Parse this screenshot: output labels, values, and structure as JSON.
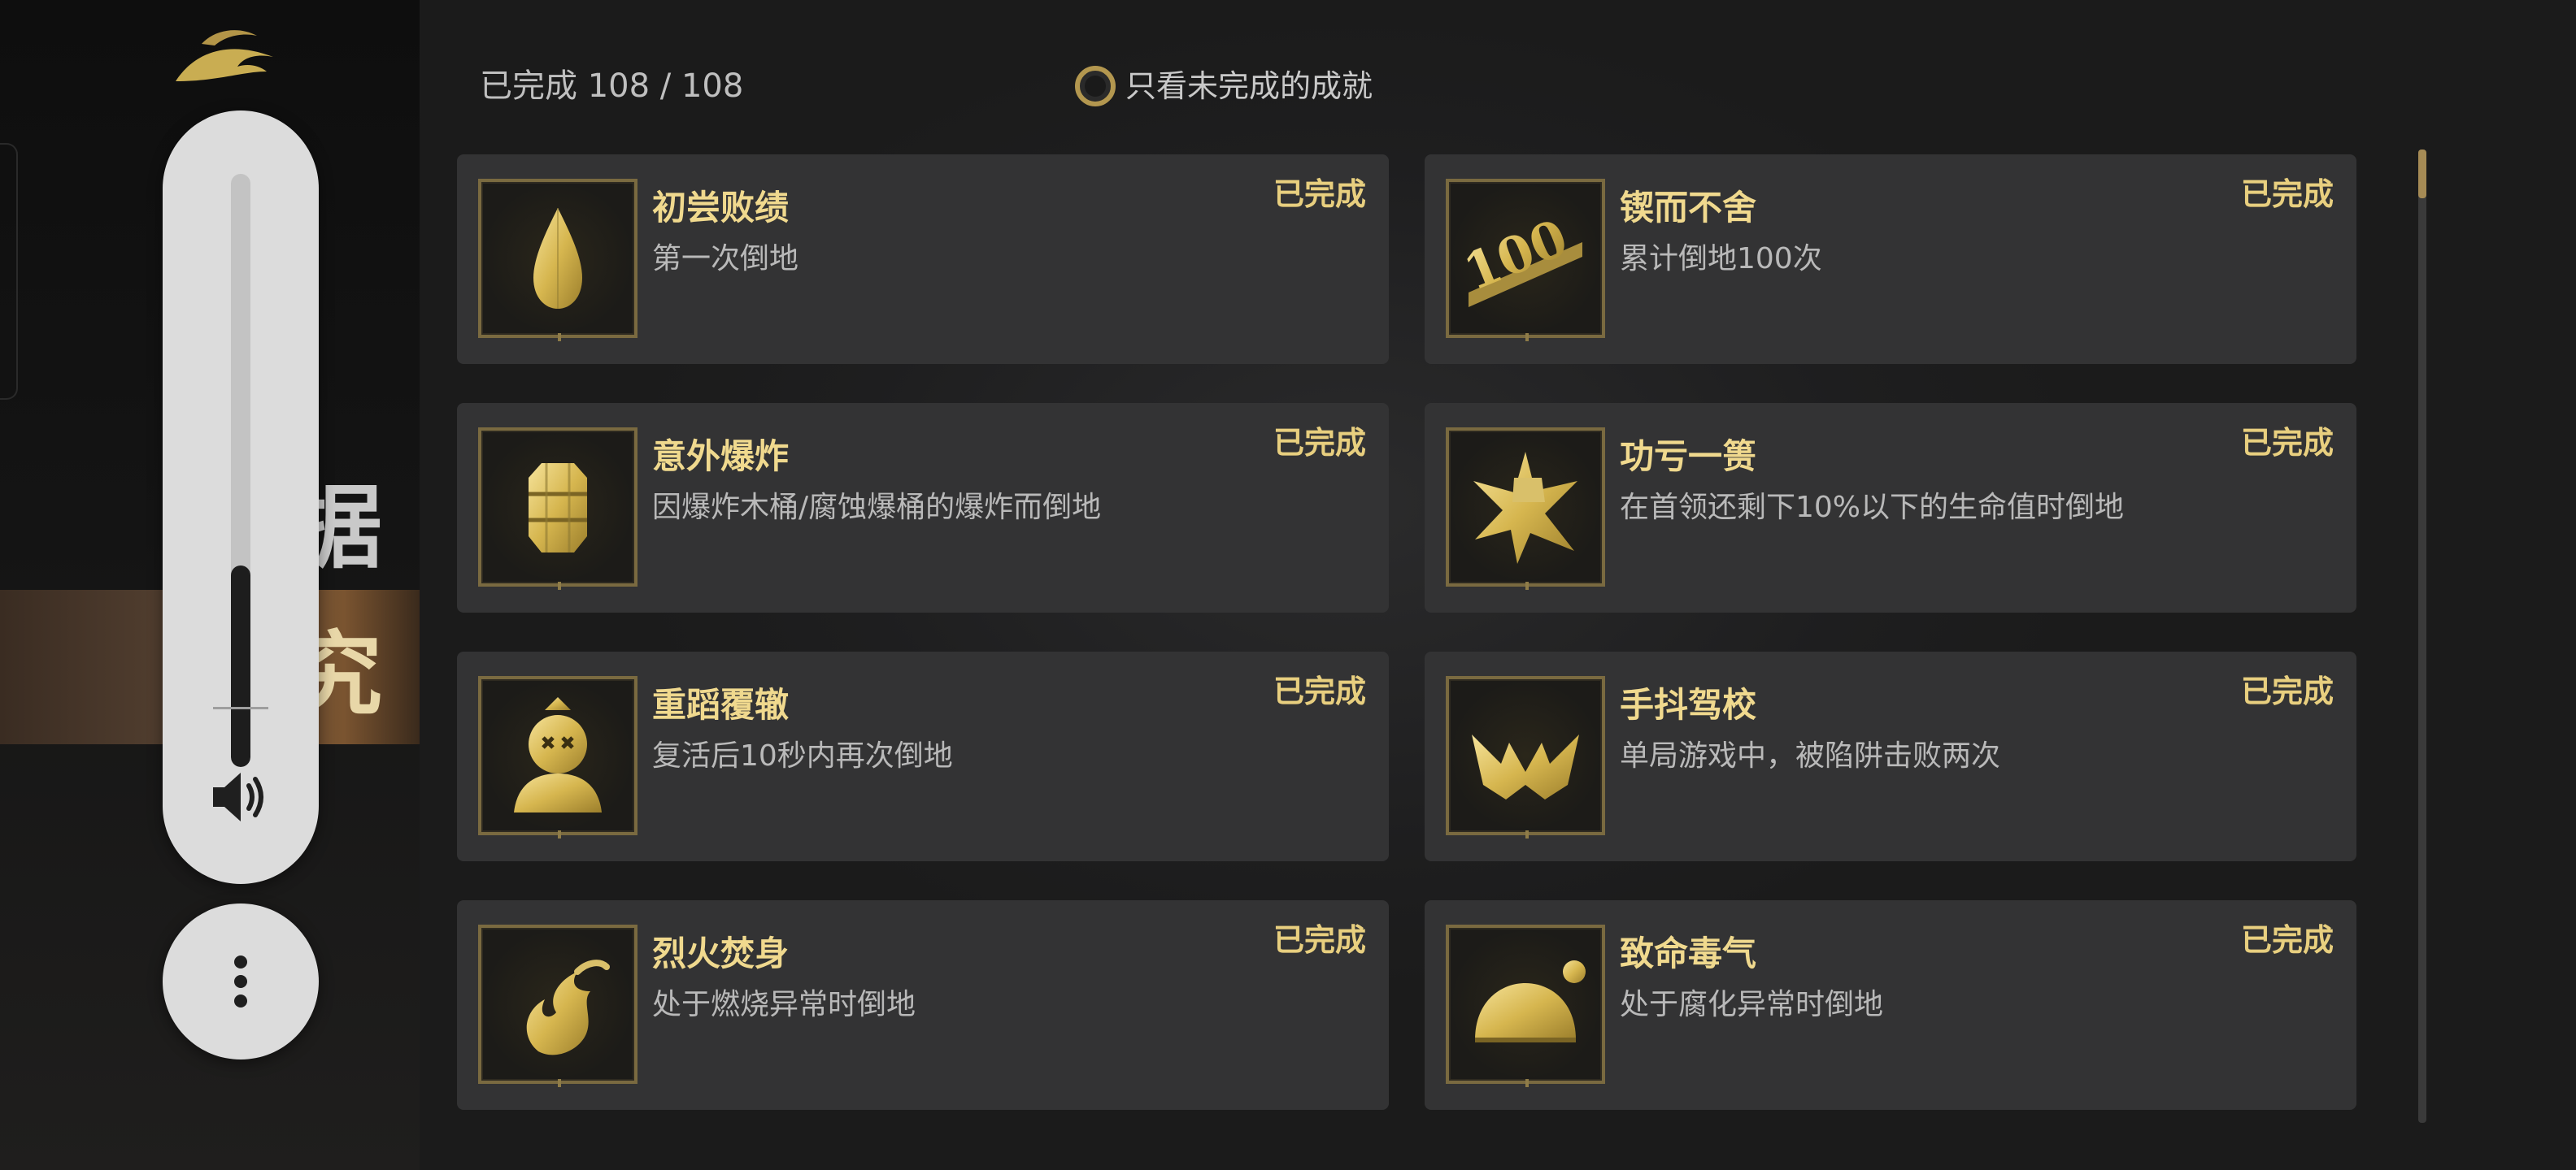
{
  "sidebar": {
    "item_one": "据",
    "item_two": "究"
  },
  "volume": {
    "level": 0.34
  },
  "header": {
    "progress": "已完成 108 / 108",
    "filter_label": "只看未完成的成就",
    "accent": "#b3974f"
  },
  "achievements": [
    {
      "title": "初尝败绩",
      "desc": "第一次倒地",
      "status": "已完成",
      "icon": "drop-icon"
    },
    {
      "title": "锲而不舍",
      "desc": "累计倒地100次",
      "status": "已完成",
      "icon": "hundred-icon"
    },
    {
      "title": "意外爆炸",
      "desc": "因爆炸木桶/腐蚀爆桶的爆炸而倒地",
      "status": "已完成",
      "icon": "barrel-icon"
    },
    {
      "title": "功亏一篑",
      "desc": "在首领还剩下10%以下的生命值时倒地",
      "status": "已完成",
      "icon": "burst-icon"
    },
    {
      "title": "重蹈覆辙",
      "desc": "复活后10秒内再次倒地",
      "status": "已完成",
      "icon": "fallen-head-icon"
    },
    {
      "title": "手抖驾校",
      "desc": "单局游戏中，被陷阱击败两次",
      "status": "已完成",
      "icon": "trap-icon"
    },
    {
      "title": "烈火焚身",
      "desc": "处于燃烧异常时倒地",
      "status": "已完成",
      "icon": "flame-icon"
    },
    {
      "title": "致命毒气",
      "desc": "处于腐化异常时倒地",
      "status": "已完成",
      "icon": "toxic-dome-icon"
    }
  ],
  "icon_100_text": "100",
  "scroll": {
    "position": 0.0,
    "visible_fraction": 0.05
  },
  "colors": {
    "title": "#f0d98e",
    "status": "#e8cf7f",
    "card": "#333334",
    "gold": "#c9ad52"
  }
}
